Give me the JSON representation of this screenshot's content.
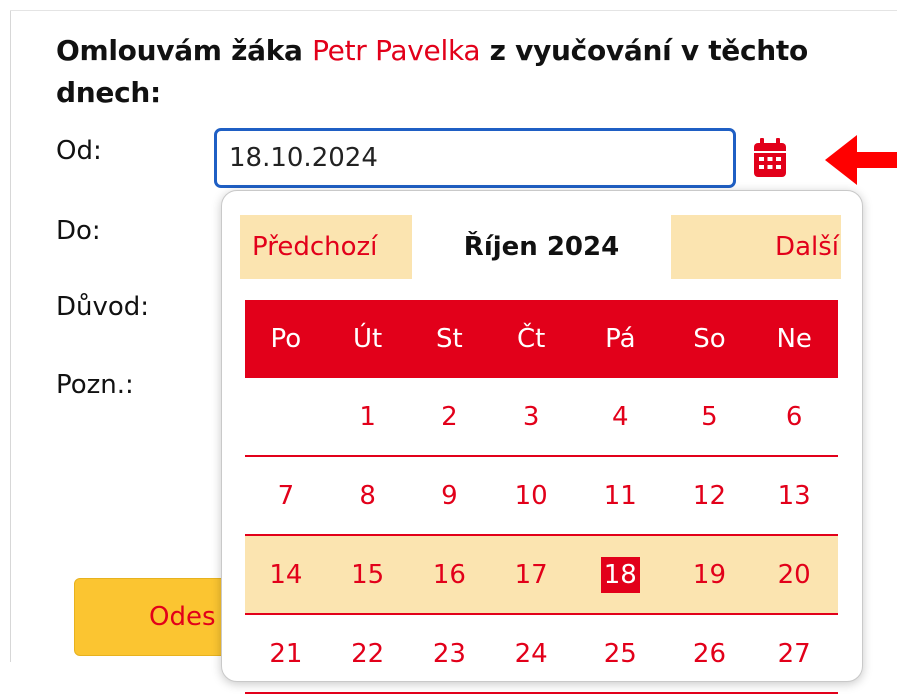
{
  "heading": {
    "prefix": "Omlouvám žáka ",
    "student_name": "Petr Pavelka",
    "suffix": " z vyučování v těchto dnech:"
  },
  "form": {
    "from_label": "Od:",
    "to_label": "Do:",
    "reason_label": "Důvod:",
    "note_label": "Pozn.:",
    "from_value": "18.10.2024",
    "submit_label": "Odes"
  },
  "datepicker": {
    "prev_label": "Předchozí",
    "next_label": "Další",
    "month_title": "Říjen 2024",
    "weekdays": [
      "Po",
      "Út",
      "St",
      "Čt",
      "Pá",
      "So",
      "Ne"
    ],
    "weeks": [
      [
        "",
        "1",
        "2",
        "3",
        "4",
        "5",
        "6"
      ],
      [
        "7",
        "8",
        "9",
        "10",
        "11",
        "12",
        "13"
      ],
      [
        "14",
        "15",
        "16",
        "17",
        "18",
        "19",
        "20"
      ],
      [
        "21",
        "22",
        "23",
        "24",
        "25",
        "26",
        "27"
      ]
    ],
    "selected_day": "18",
    "current_week_index": 2
  },
  "icons": {
    "calendar": "calendar-icon",
    "arrow": "arrow-left-icon"
  },
  "colors": {
    "accent_red": "#e2001a",
    "highlight_yellow": "#fbe4b0",
    "button_yellow": "#fbc531",
    "input_border_blue": "#1f5fc4"
  }
}
